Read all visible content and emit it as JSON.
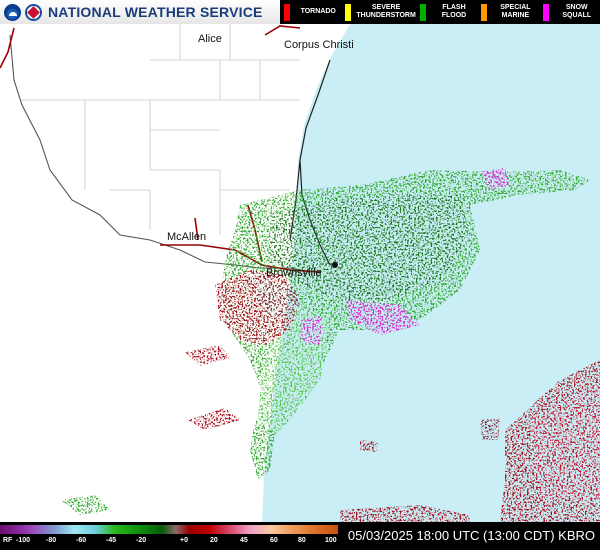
{
  "header": {
    "agency": "NATIONAL WEATHER SERVICE",
    "logos": [
      "noaa-logo",
      "nws-logo"
    ]
  },
  "warnings_legend": [
    {
      "label": "TORNADO",
      "color": "#ff0000"
    },
    {
      "label": "SEVERE THUNDERSTORM",
      "color": "#ffff00"
    },
    {
      "label": "FLASH FLOOD",
      "color": "#00b000"
    },
    {
      "label": "SPECIAL MARINE",
      "color": "#ff9900"
    },
    {
      "label": "SNOW SQUALL",
      "color": "#ff00ff"
    }
  ],
  "cities": {
    "alice": "Alice",
    "corpus_christi": "Corpus Christi",
    "mcallen": "McAllen",
    "brownsville": "Brownsville"
  },
  "footer": {
    "scale_label": "RF",
    "scale_ticks": [
      "-100",
      "-80",
      "-60",
      "-45",
      "-20",
      "+0",
      "20",
      "45",
      "60",
      "80",
      "100"
    ],
    "timestamp": "05/03/2025 18:00 UTC (13:00 CDT) KBRO"
  },
  "colors": {
    "gulf": "#c9eef5",
    "land": "#ffffff",
    "inbound_velocity": "#2fa82a",
    "outbound_velocity": "#a8101a",
    "range_folded": "#e020d8"
  }
}
